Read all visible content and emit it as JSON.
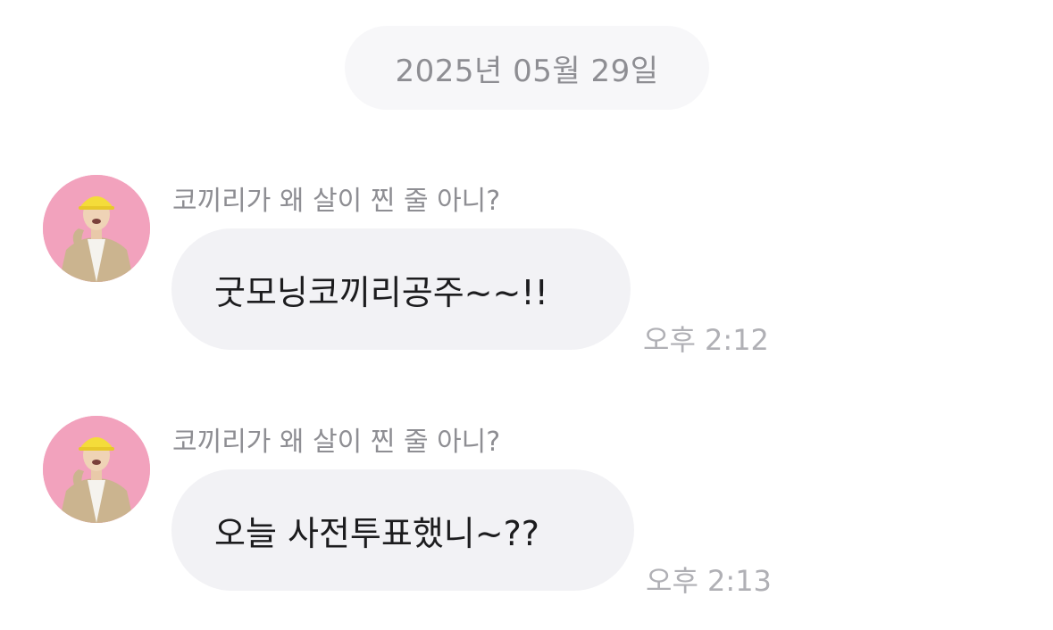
{
  "chat": {
    "date_separator": "2025년 05월 29일",
    "messages": [
      {
        "sender": "코끼리가 왜 살이 찐 줄 아니?",
        "text": "굿모닝코끼리공주~~!!",
        "time": "오후 2:12",
        "avatar_icon": "profile-photo"
      },
      {
        "sender": "코끼리가 왜 살이 찐 줄 아니?",
        "text": "오늘 사전투표했니~??",
        "time": "오후 2:13",
        "avatar_icon": "profile-photo"
      }
    ]
  },
  "colors": {
    "background": "#ffffff",
    "date_pill_bg": "#f7f7f9",
    "bubble_bg": "#f2f2f5",
    "secondary_text": "#8e8e93",
    "time_text": "#b0b0b5",
    "avatar_bg": "#f2a2bd"
  }
}
